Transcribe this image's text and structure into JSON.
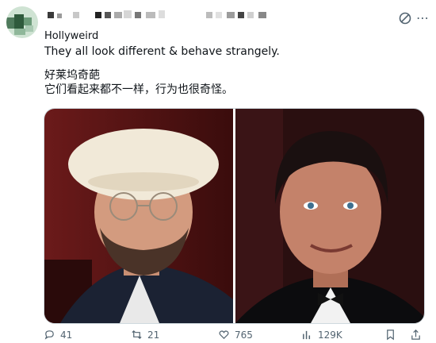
{
  "post": {
    "display_name": "Hollyweird",
    "text_en": "They all look different & behave strangely.",
    "text_zh_1": "好莱坞奇葩",
    "text_zh_2": "它们看起来都不一样，行为也很奇怪。"
  },
  "media": {
    "left_photo": "man-in-white-beret-and-glasses-photo",
    "right_photo": "dark-haired-man-in-tuxedo-photo"
  },
  "actions": {
    "replies": "41",
    "reposts": "21",
    "likes": "765",
    "views": "129K"
  },
  "icons": [
    "grok-icon",
    "reply-icon",
    "repost-icon",
    "like-icon",
    "views-icon",
    "bookmark-icon",
    "share-icon"
  ],
  "colors": {
    "text": "#0f1419",
    "muted": "#536471",
    "border": "#cfd9de",
    "accent": "#1d9bf0"
  }
}
